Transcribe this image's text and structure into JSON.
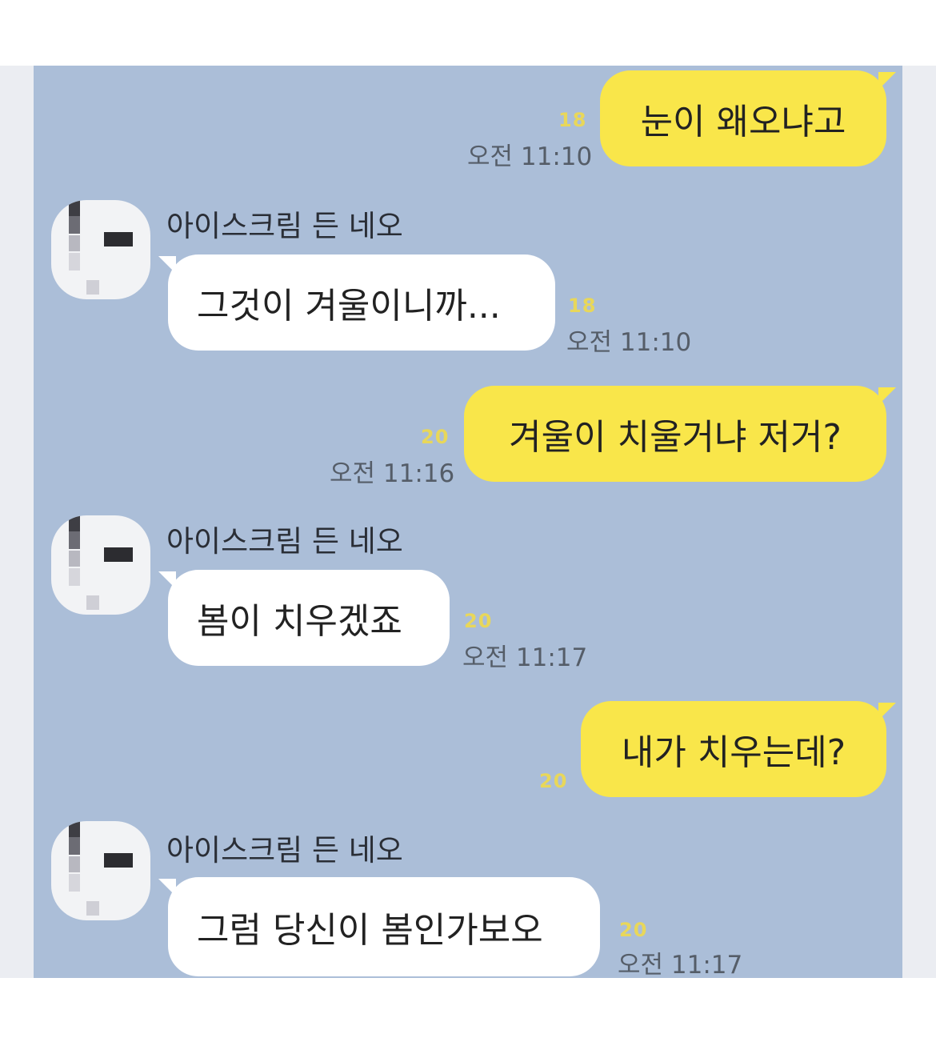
{
  "contact": {
    "name": "아이스크림 든 네오"
  },
  "messages": [
    {
      "from": "me",
      "text": "눈이 왜오냐고",
      "unread": "18",
      "time": "오전 11:10"
    },
    {
      "from": "them",
      "text": "그것이 겨울이니까...",
      "unread": "18",
      "time": "오전 11:10"
    },
    {
      "from": "me",
      "text": "겨울이 치울거냐 저거?",
      "unread": "20",
      "time": "오전 11:16"
    },
    {
      "from": "them",
      "text": "봄이 치우겠죠",
      "unread": "20",
      "time": "오전 11:17"
    },
    {
      "from": "me",
      "text": "내가 치우는데?",
      "unread": "20"
    },
    {
      "from": "them",
      "text": "그럼 당신이 봄인가보오",
      "unread": "20",
      "time": "오전 11:17"
    }
  ],
  "colors": {
    "chat_background": "#abbed8",
    "my_bubble": "#f9e64a",
    "their_bubble": "#ffffff",
    "unread_count": "#e8d75a"
  }
}
